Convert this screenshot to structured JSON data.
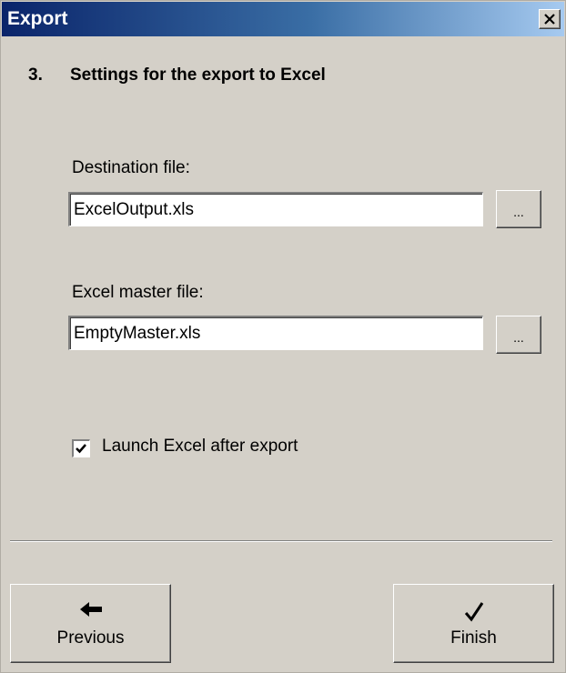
{
  "window": {
    "title": "Export",
    "close_icon": "close-icon"
  },
  "step": {
    "number": "3.",
    "title": "Settings for the export to Excel"
  },
  "destination": {
    "label": "Destination file:",
    "value": "ExcelOutput.xls",
    "browse_label": "..."
  },
  "master": {
    "label": "Excel master file:",
    "value": "EmptyMaster.xls",
    "browse_label": "..."
  },
  "launch": {
    "label": "Launch Excel after export",
    "checked": true
  },
  "buttons": {
    "previous": {
      "label": "Previous",
      "icon": "arrow-left-icon"
    },
    "finish": {
      "label": "Finish",
      "icon": "checkmark-icon"
    }
  },
  "colors": {
    "title_gradient_start": "#0a246a",
    "title_gradient_end": "#a6caf0",
    "face": "#d4d0c8"
  }
}
